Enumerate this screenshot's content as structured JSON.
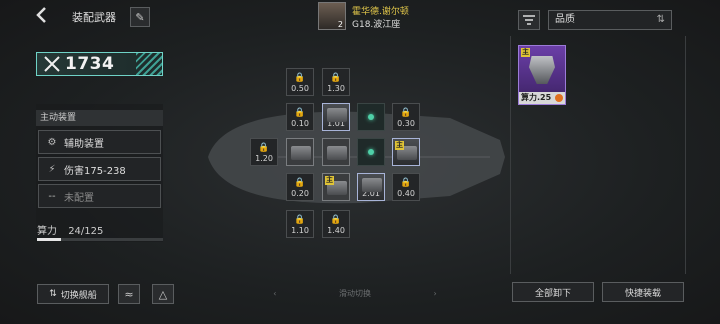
{
  "header": {
    "back_icon": "chevron-left-icon",
    "title": "装配武器",
    "edit_icon": "pen-icon"
  },
  "player": {
    "name": "霍华德.谢尔顿",
    "galaxy": "G18.波江座",
    "level": "2"
  },
  "power": {
    "value": "1734",
    "icon": "crossed-swords-icon"
  },
  "left_panel": {
    "section_title": "主动装置",
    "slots": [
      {
        "icon": "assist-device-icon",
        "label": "辅助装置"
      },
      {
        "icon": "damage-icon",
        "label": "伤害175-238"
      },
      {
        "icon": "dash-icon",
        "label": "未配置"
      }
    ],
    "calc_label": "算力",
    "calc_value": "24/125",
    "calc_fraction": 0.19
  },
  "bottom": {
    "switch_ship": "切换舰船",
    "swipe_hint": "滑动切换",
    "unload_all": "全部卸下",
    "quick_equip": "快捷装载"
  },
  "grid": {
    "r0c1": "0.50",
    "r0c2": "1.30",
    "r1c1": "0.10",
    "r1c2": "1.01",
    "r1c4": "0.30",
    "r2c0": "1.20",
    "r3c1": "0.20",
    "r3c3": "2.01",
    "r3c4": "0.40",
    "r4c1": "1.10",
    "r4c2": "1.40",
    "badge": "主"
  },
  "filter": {
    "quality_label": "品质",
    "filter_icon": "filter-icon",
    "sort_icon": "sort-icon"
  },
  "inventory": [
    {
      "badge": "主",
      "caption": "算力.25",
      "color": "#6b3fa8"
    }
  ],
  "colors": {
    "accent": "#6fd3c7",
    "badge": "#e0c436",
    "epic": "#6b3fa8"
  }
}
